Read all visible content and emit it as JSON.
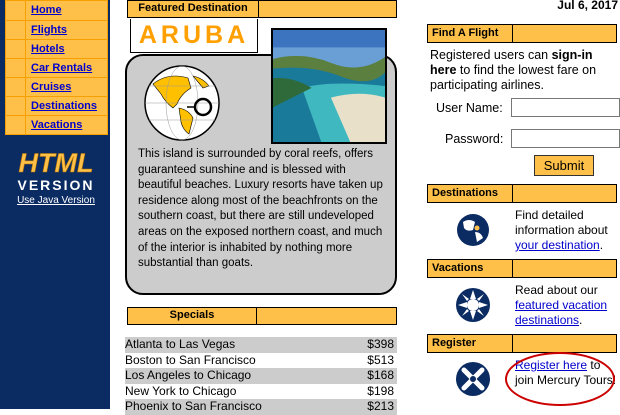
{
  "nav": {
    "items": [
      {
        "label": "Home"
      },
      {
        "label": "Flights"
      },
      {
        "label": "Hotels"
      },
      {
        "label": "Car Rentals"
      },
      {
        "label": "Cruises"
      },
      {
        "label": "Destinations"
      },
      {
        "label": "Vacations"
      }
    ],
    "logo_top": "HTML",
    "logo_bottom": "VERSION",
    "java_link": "Use Java Version"
  },
  "date": "Jul 6, 2017",
  "featured": {
    "header": "Featured Destination",
    "title": "ARUBA",
    "description": "This island is surrounded by coral reefs, offers guaranteed sunshine and is blessed with beautiful beaches. Luxury resorts have taken up residence along most of the beachfronts on the southern coast, but there are still undeveloped areas on the exposed northern coast, and much of the interior is inhabited by nothing more substantial than goats."
  },
  "specials": {
    "header": "Specials",
    "rows": [
      {
        "route": "Atlanta to Las Vegas",
        "price": "$398"
      },
      {
        "route": "Boston to San Francisco",
        "price": "$513"
      },
      {
        "route": "Los Angeles to Chicago",
        "price": "$168"
      },
      {
        "route": "New York to Chicago",
        "price": "$198"
      },
      {
        "route": "Phoenix to San Francisco",
        "price": "$213"
      }
    ]
  },
  "find_flight": {
    "header": "Find A Flight",
    "text_pre": "Registered users can ",
    "text_bold": "sign-in here",
    "text_post": " to find the lowest fare on participating airlines.",
    "username_label": "User Name:",
    "password_label": "Password:",
    "submit_label": "Submit"
  },
  "destinations": {
    "header": "Destinations",
    "text_pre": "Find detailed information about",
    "link": "your destination",
    "text_post": "."
  },
  "vacations": {
    "header": "Vacations",
    "text_pre": "Read about our",
    "link": "featured vacation destinations",
    "text_post": "."
  },
  "register": {
    "header": "Register",
    "link": "Register here",
    "text_post": " to join Mercury Tours!"
  },
  "colors": {
    "navy": "#0b2b63",
    "gold": "#ffc04a",
    "orange_text": "#ffa000",
    "annotation_red": "#cc0000"
  }
}
